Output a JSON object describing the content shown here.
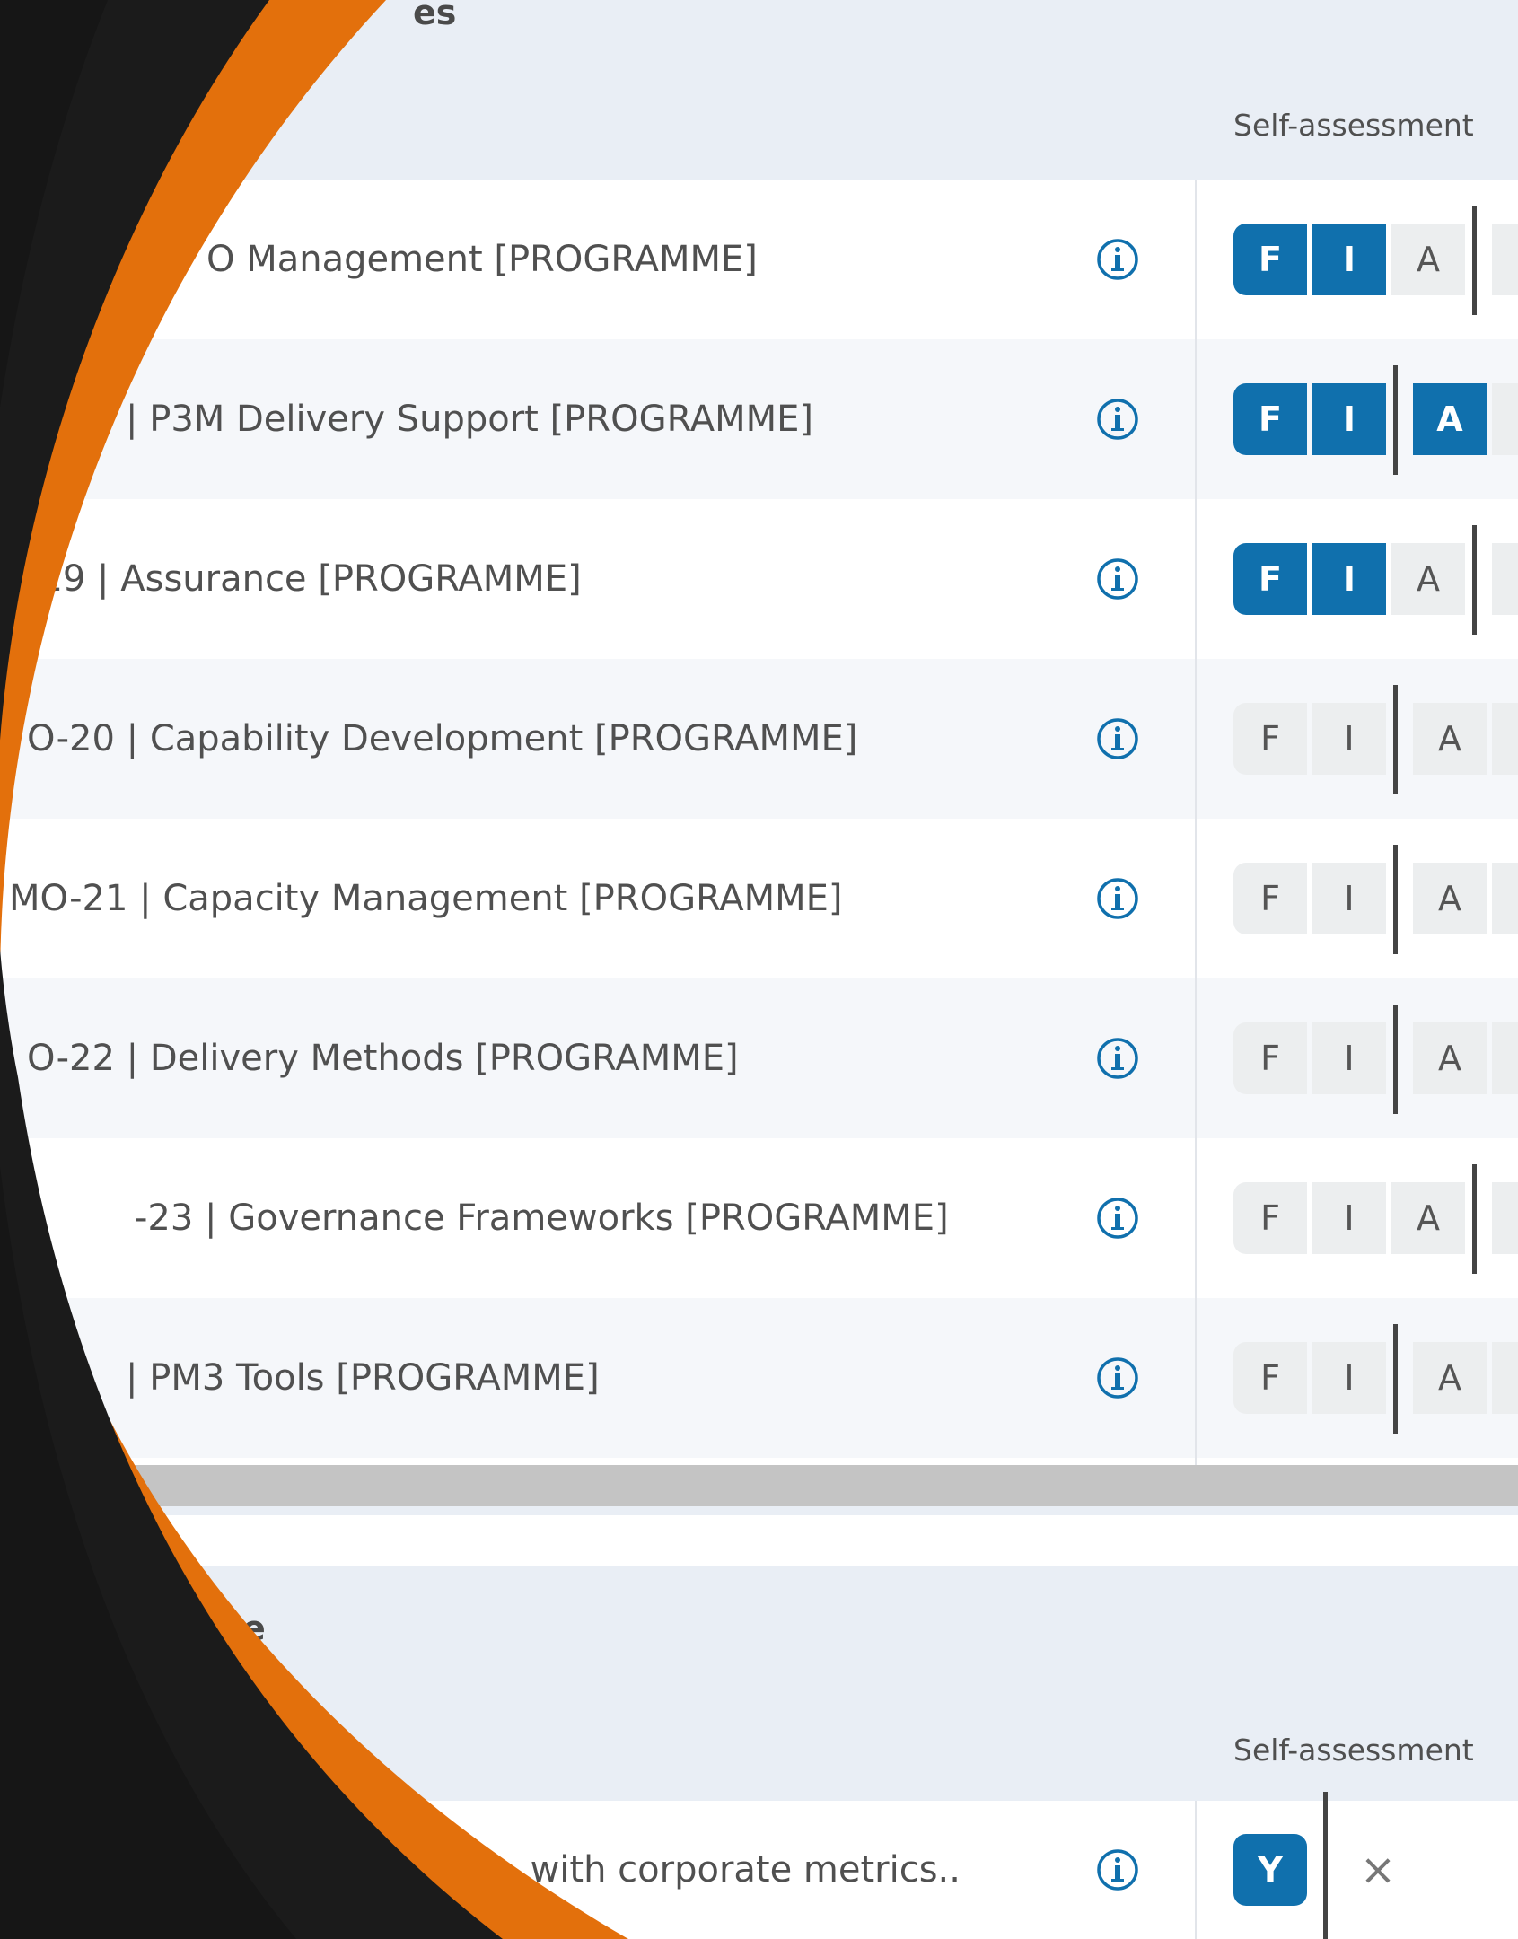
{
  "section1": {
    "title_fragment": "es",
    "column_header": "Self-assessment"
  },
  "rows": [
    {
      "label": "O Management [PROGRAMME]",
      "levels": [
        "F",
        "I",
        "A"
      ],
      "on": [
        true,
        true,
        false
      ],
      "bar_after": 3
    },
    {
      "label": "| P3M Delivery Support [PROGRAMME]",
      "levels": [
        "F",
        "I",
        "A"
      ],
      "on": [
        true,
        true,
        true
      ],
      "bar_after": 2
    },
    {
      "label": "-19 | Assurance [PROGRAMME]",
      "levels": [
        "F",
        "I",
        "A"
      ],
      "on": [
        true,
        true,
        false
      ],
      "bar_after": 3
    },
    {
      "label": "O-20 | Capability Development [PROGRAMME]",
      "levels": [
        "F",
        "I",
        "A"
      ],
      "on": [
        false,
        false,
        false
      ],
      "bar_after": 2
    },
    {
      "label": "MO-21 | Capacity Management [PROGRAMME]",
      "levels": [
        "F",
        "I",
        "A"
      ],
      "on": [
        false,
        false,
        false
      ],
      "bar_after": 2
    },
    {
      "label": "O-22 | Delivery Methods [PROGRAMME]",
      "levels": [
        "F",
        "I",
        "A"
      ],
      "on": [
        false,
        false,
        false
      ],
      "bar_after": 2
    },
    {
      "label": "-23 | Governance Frameworks [PROGRAMME]",
      "levels": [
        "F",
        "I",
        "A"
      ],
      "on": [
        false,
        false,
        false
      ],
      "bar_after": 3
    },
    {
      "label": "| PM3 Tools [PROGRAMME]",
      "levels": [
        "F",
        "I",
        "A"
      ],
      "on": [
        false,
        false,
        false
      ],
      "bar_after": 2
    }
  ],
  "section2": {
    "title_fragment": "e",
    "column_header": "Self-assessment",
    "row": {
      "label": "with corporate metrics..",
      "yes_label": "Y",
      "no_label": "×"
    }
  },
  "colors": {
    "accent": "#1070ad",
    "header_bg": "#e9eef5",
    "overlay_orange": "#e3700c",
    "overlay_dark": "#1b1b1b"
  },
  "icons": {
    "row_info": "info-circle-icon",
    "no_option": "close-icon"
  }
}
